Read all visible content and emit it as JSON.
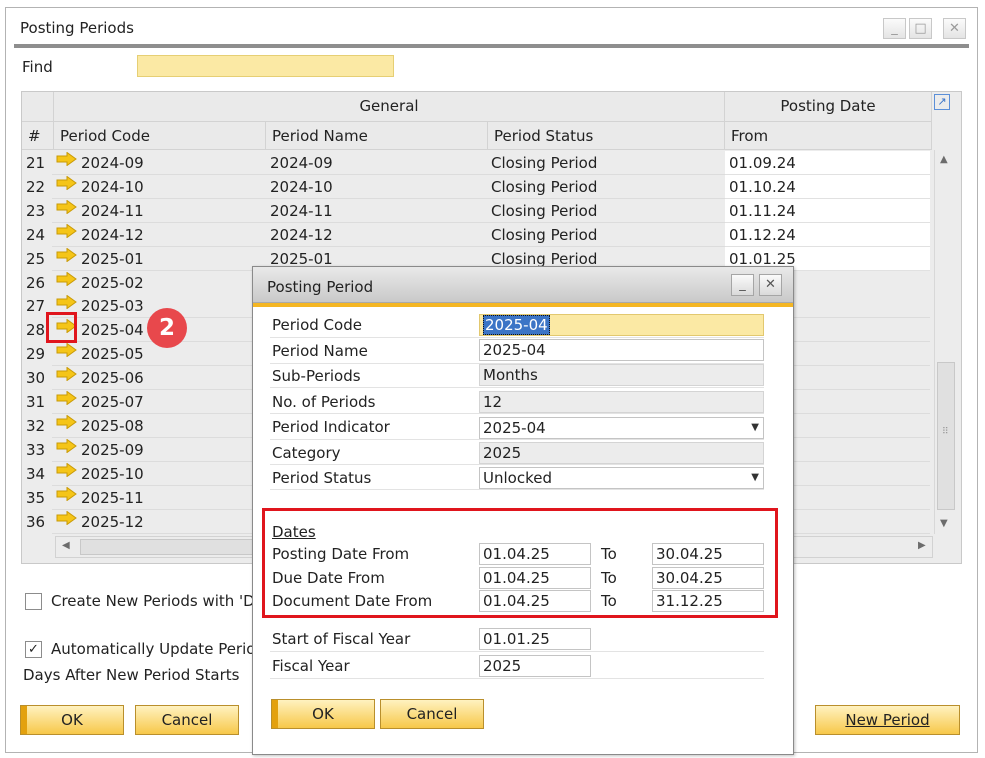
{
  "window": {
    "title": "Posting Periods",
    "controls": [
      "_",
      "□",
      "✕"
    ]
  },
  "find": {
    "label": "Find",
    "value": ""
  },
  "grid": {
    "group_general": "General",
    "group_posting_date": "Posting Date",
    "columns": {
      "num": "#",
      "code": "Period Code",
      "name": "Period Name",
      "status": "Period Status",
      "from": "From"
    },
    "rows": [
      {
        "num": "21",
        "code": "2024-09",
        "name": "2024-09",
        "status": "Closing Period",
        "from": "01.09.24"
      },
      {
        "num": "22",
        "code": "2024-10",
        "name": "2024-10",
        "status": "Closing Period",
        "from": "01.10.24"
      },
      {
        "num": "23",
        "code": "2024-11",
        "name": "2024-11",
        "status": "Closing Period",
        "from": "01.11.24"
      },
      {
        "num": "24",
        "code": "2024-12",
        "name": "2024-12",
        "status": "Closing Period",
        "from": "01.12.24"
      },
      {
        "num": "25",
        "code": "2025-01",
        "name": "2025-01",
        "status": "Closing Period",
        "from": "01.01.25"
      },
      {
        "num": "26",
        "code": "2025-02"
      },
      {
        "num": "27",
        "code": "2025-03"
      },
      {
        "num": "28",
        "code": "2025-04"
      },
      {
        "num": "29",
        "code": "2025-05"
      },
      {
        "num": "30",
        "code": "2025-06"
      },
      {
        "num": "31",
        "code": "2025-07"
      },
      {
        "num": "32",
        "code": "2025-08"
      },
      {
        "num": "33",
        "code": "2025-09"
      },
      {
        "num": "34",
        "code": "2025-10"
      },
      {
        "num": "35",
        "code": "2025-11"
      },
      {
        "num": "36",
        "code": "2025-12"
      }
    ]
  },
  "options": {
    "create_new_periods": "Create New Periods with 'D",
    "auto_update": "Automatically Update Period",
    "days_after": "Days After New Period Starts"
  },
  "buttons": {
    "ok": "OK",
    "cancel": "Cancel",
    "new_period": "New Period"
  },
  "annotation": {
    "step": "2"
  },
  "dialog": {
    "title": "Posting Period",
    "controls": [
      "_",
      "✕"
    ],
    "fields": {
      "period_code": {
        "label": "Period Code",
        "value": "2025-04"
      },
      "period_name": {
        "label": "Period Name",
        "value": "2025-04"
      },
      "sub_periods": {
        "label": "Sub-Periods",
        "value": "Months"
      },
      "no_periods": {
        "label": "No. of Periods",
        "value": "12"
      },
      "period_indicator": {
        "label": "Period Indicator",
        "value": "2025-04"
      },
      "category": {
        "label": "Category",
        "value": "2025"
      },
      "period_status": {
        "label": "Period Status",
        "value": "Unlocked"
      }
    },
    "dates": {
      "heading": "Dates",
      "to_label": "To",
      "posting": {
        "label": "Posting Date From",
        "from": "01.04.25",
        "to": "30.04.25"
      },
      "due": {
        "label": "Due Date From",
        "from": "01.04.25",
        "to": "30.04.25"
      },
      "document": {
        "label": "Document Date From",
        "from": "01.04.25",
        "to": "31.12.25"
      }
    },
    "start_fiscal_year": {
      "label": "Start of Fiscal Year",
      "value": "01.01.25"
    },
    "fiscal_year": {
      "label": "Fiscal Year",
      "value": "2025"
    },
    "ok": "OK",
    "cancel": "Cancel"
  },
  "colors": {
    "accent_gold": "#f4b623",
    "button_gradient_bottom": "#f7c84a",
    "find_highlight": "#fbe9a4",
    "annotation_red": "#e0151d",
    "badge_red": "#e8484c",
    "arrow_yellow": "#f5c518"
  }
}
